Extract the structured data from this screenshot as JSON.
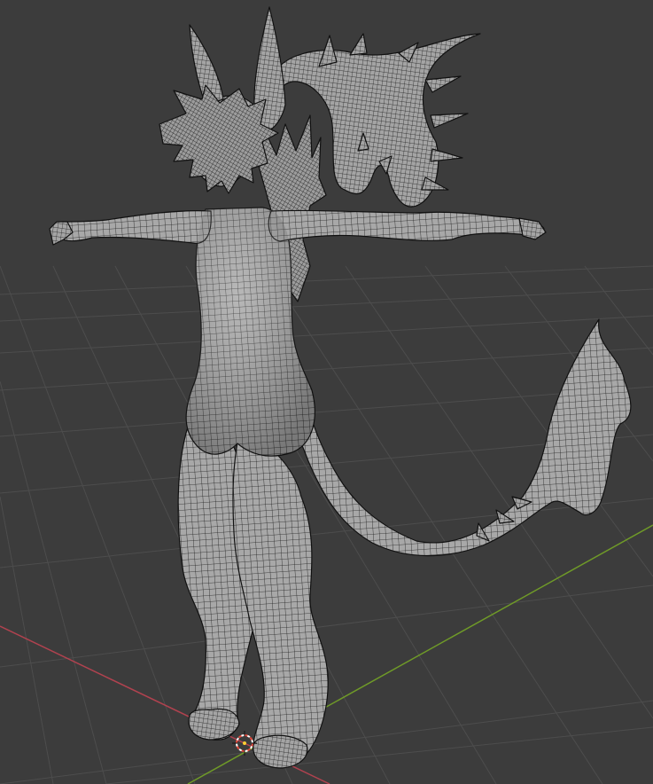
{
  "app": {
    "name": "3D Viewport"
  },
  "viewport": {
    "background_color": "#3c3c3c",
    "grid_color": "#4d4d4d",
    "x_axis_color": "#b0424f",
    "y_axis_color": "#6f9a28",
    "mesh_fill_color": "#a9a9a9",
    "wire_color": "#1a1a1a",
    "display_mode": "wireframe-overlay",
    "icons": [
      "3d-cursor-icon"
    ]
  },
  "scene": {
    "object": {
      "name": "creature-mesh",
      "type": "mesh",
      "pose": "t-pose"
    }
  }
}
